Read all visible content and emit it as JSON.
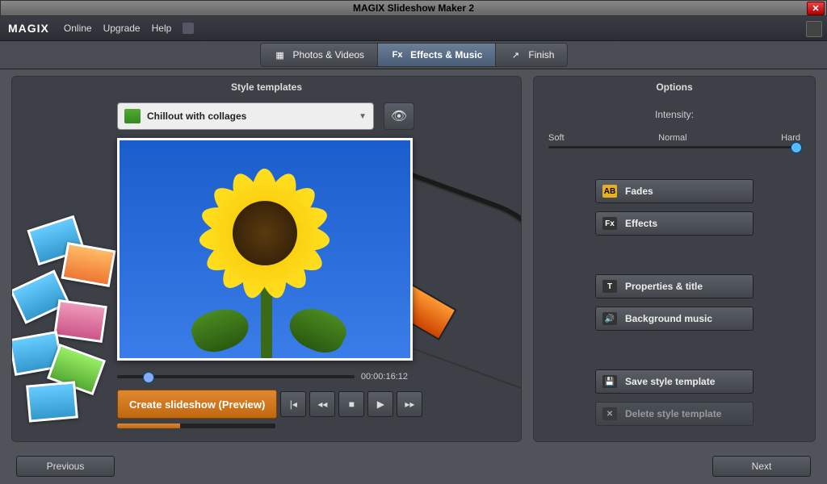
{
  "window": {
    "title": "MAGIX Slideshow Maker 2"
  },
  "brand": "MAGIX",
  "menu": {
    "online": "Online",
    "upgrade": "Upgrade",
    "help": "Help"
  },
  "tabs": {
    "photos": "Photos & Videos",
    "effects": "Effects & Music",
    "finish": "Finish"
  },
  "left_panel": {
    "header": "Style templates",
    "template_selected": "Chillout with collages",
    "timecode": "00:00:16:12",
    "create_btn": "Create slideshow (Preview)"
  },
  "right_panel": {
    "header": "Options",
    "intensity_label": "Intensity:",
    "intensity_scale": {
      "soft": "Soft",
      "normal": "Normal",
      "hard": "Hard"
    },
    "buttons": {
      "fades": "Fades",
      "effects": "Effects",
      "properties": "Properties & title",
      "music": "Background music",
      "save": "Save style template",
      "delete": "Delete style template"
    }
  },
  "footer": {
    "previous": "Previous",
    "next": "Next"
  }
}
